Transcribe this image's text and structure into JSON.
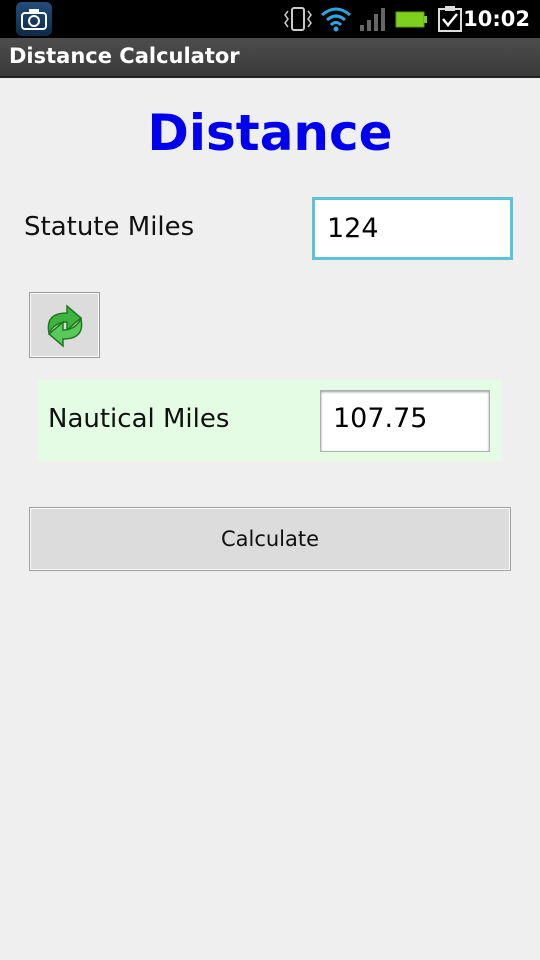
{
  "status_bar": {
    "time": "10:02"
  },
  "app": {
    "title": "Distance Calculator"
  },
  "main": {
    "heading": "Distance",
    "statute_label": "Statute Miles",
    "statute_value": "124",
    "nautical_label": "Nautical Miles",
    "nautical_value": "107.75",
    "calculate_label": "Calculate"
  },
  "colors": {
    "heading": "#0000ee",
    "nautical_panel": "#e4fce4",
    "focus_border": "#5bc2d9"
  },
  "icons": {
    "status_left": "camera-icon",
    "status_right": [
      "vibrate-icon",
      "wifi-icon",
      "signal-icon",
      "battery-icon",
      "task-check-icon"
    ],
    "swap": "swap-arrows-icon"
  }
}
